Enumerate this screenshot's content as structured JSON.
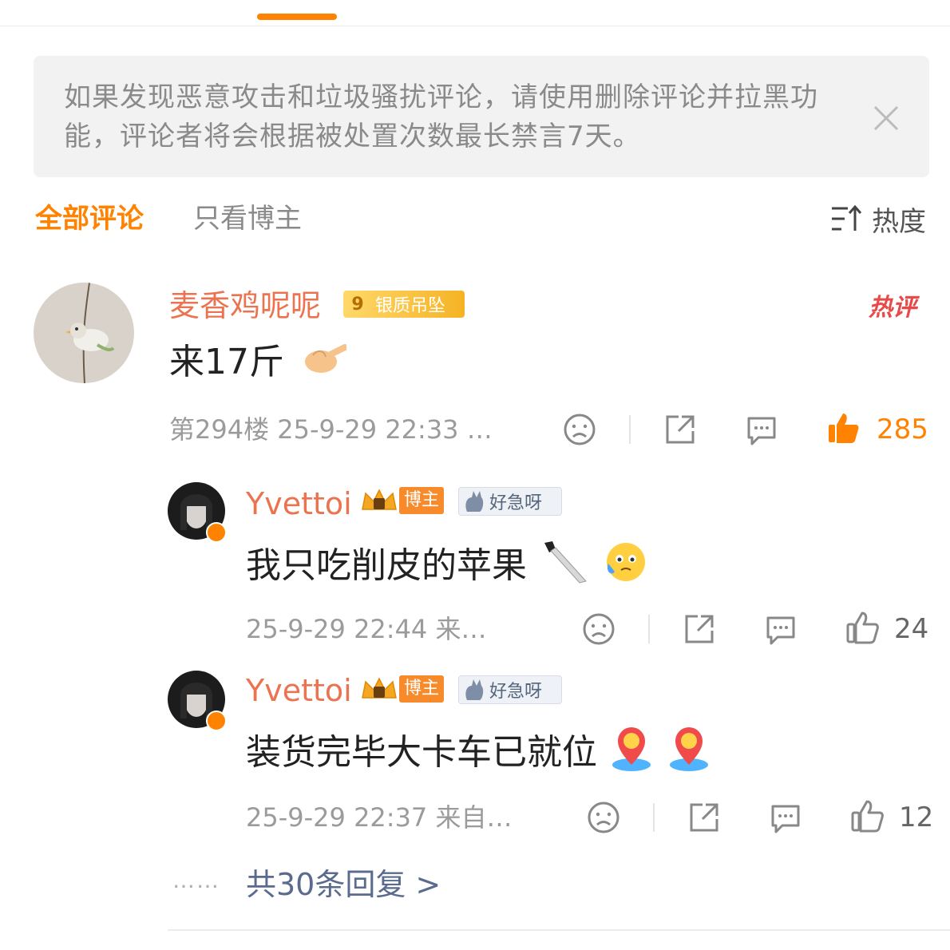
{
  "notice": {
    "text": "如果发现恶意攻击和垃圾骚扰评论，请使用删除评论并拉黑功能，评论者将会根据被处置次数最长禁言7天。"
  },
  "tabs": {
    "all": "全部评论",
    "blogger_only": "只看博主"
  },
  "sort": {
    "label": "热度"
  },
  "comment": {
    "username": "麦香鸡呢呢",
    "level": "9",
    "badge": "银质吊坠",
    "hot_label": "热评",
    "text": "来17斤",
    "meta": "第294楼 25-9-29 22:33 …",
    "likes": "285"
  },
  "replies": [
    {
      "username": "Yvettoi",
      "role_badge": "博主",
      "fan_badge": "好急呀",
      "text": "我只吃削皮的苹果",
      "meta": "25-9-29 22:44 来…",
      "likes": "24"
    },
    {
      "username": "Yvettoi",
      "role_badge": "博主",
      "fan_badge": "好急呀",
      "text": "装货完毕大卡车已就位",
      "meta": "25-9-29 22:37 来自…",
      "likes": "12"
    }
  ],
  "more_replies": {
    "dots": "……",
    "label": "共30条回复 >"
  },
  "colors": {
    "accent": "#ff8200",
    "username": "#eb7350",
    "like_active": "#ff8200",
    "link": "#5a6b8e"
  }
}
